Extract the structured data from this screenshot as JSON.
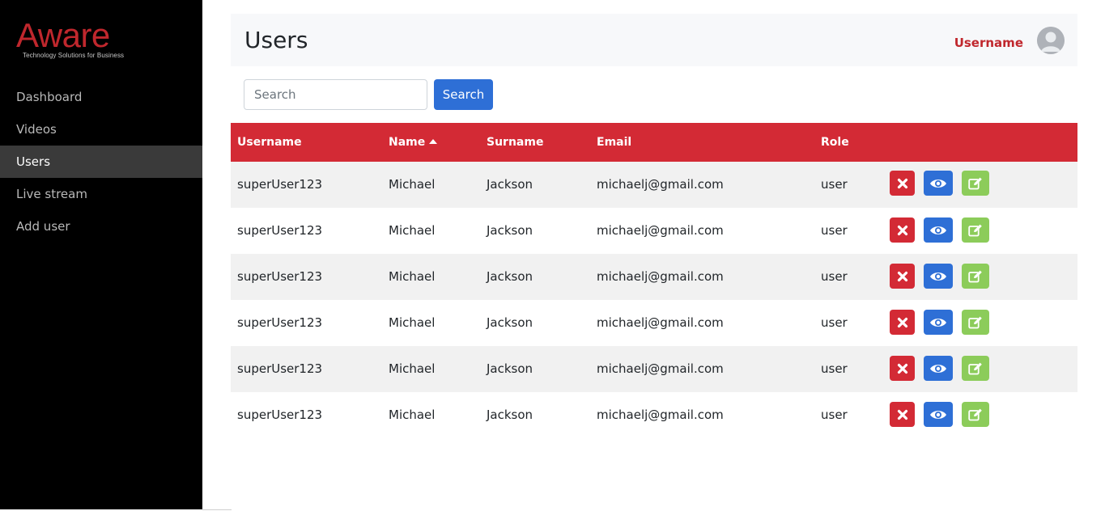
{
  "brand": {
    "name": "Aware",
    "tagline": "Technology Solutions for Business",
    "color": "#c0272d"
  },
  "sidebar": {
    "items": [
      {
        "label": "Dashboard",
        "active": false
      },
      {
        "label": "Videos",
        "active": false
      },
      {
        "label": "Users",
        "active": true
      },
      {
        "label": "Live stream",
        "active": false
      },
      {
        "label": "Add user",
        "active": false
      }
    ]
  },
  "header": {
    "title": "Users",
    "username": "Username",
    "avatar_icon": "user-avatar-icon"
  },
  "search": {
    "placeholder": "Search",
    "value": "",
    "button_label": "Search"
  },
  "table": {
    "columns": [
      "Username",
      "Name",
      "Surname",
      "Email",
      "Role"
    ],
    "sorted_by": "Name",
    "sort_direction": "ascending",
    "header_color": "#d32a35",
    "rows": [
      {
        "username": "superUser123",
        "name": "Michael",
        "surname": "Jackson",
        "email": "michaelj@gmail.com",
        "role": "user"
      },
      {
        "username": "superUser123",
        "name": "Michael",
        "surname": "Jackson",
        "email": "michaelj@gmail.com",
        "role": "user"
      },
      {
        "username": "superUser123",
        "name": "Michael",
        "surname": "Jackson",
        "email": "michaelj@gmail.com",
        "role": "user"
      },
      {
        "username": "superUser123",
        "name": "Michael",
        "surname": "Jackson",
        "email": "michaelj@gmail.com",
        "role": "user"
      },
      {
        "username": "superUser123",
        "name": "Michael",
        "surname": "Jackson",
        "email": "michaelj@gmail.com",
        "role": "user"
      },
      {
        "username": "superUser123",
        "name": "Michael",
        "surname": "Jackson",
        "email": "michaelj@gmail.com",
        "role": "user"
      }
    ],
    "row_actions": [
      {
        "icon": "close-icon",
        "action": "delete",
        "color": "#d32a35"
      },
      {
        "icon": "eye-icon",
        "action": "view",
        "color": "#2e6fd6"
      },
      {
        "icon": "edit-icon",
        "action": "edit",
        "color": "#8ccc5a"
      }
    ]
  }
}
